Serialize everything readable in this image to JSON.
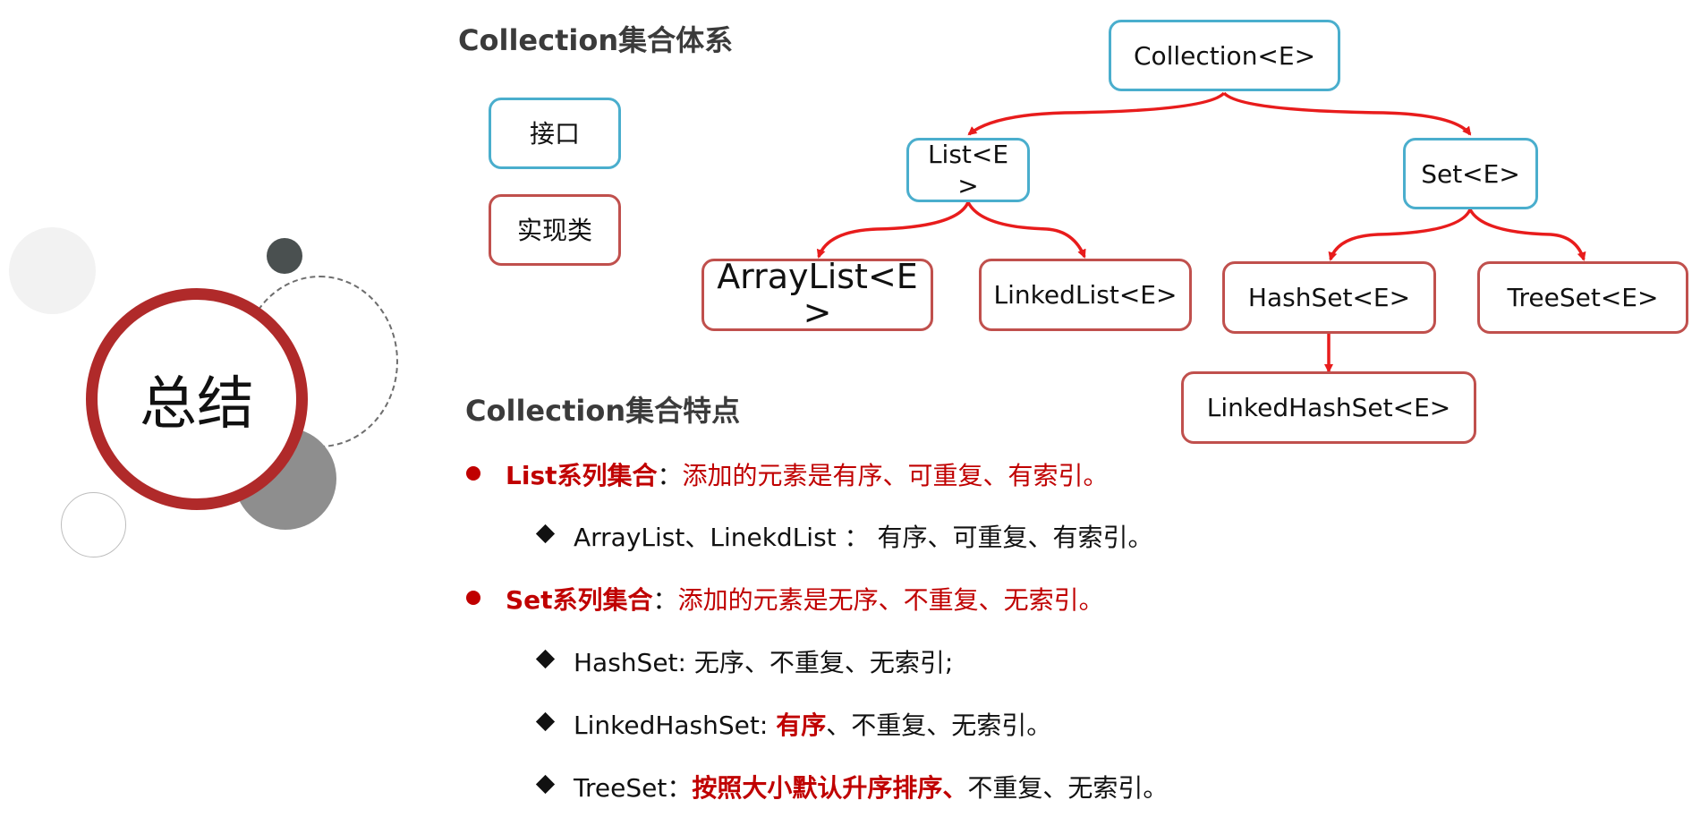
{
  "headings": {
    "system_title": "Collection集合体系",
    "features_title": "Collection集合特点"
  },
  "legend": {
    "interface_label": "接口",
    "impl_label": "实现类"
  },
  "summary_label": "总结",
  "tree": {
    "collection": "Collection<E>",
    "list": "List<E>",
    "set": "Set<E>",
    "arraylist": "ArrayList<E>",
    "linkedlist": "LinkedList<E>",
    "hashset": "HashSet<E>",
    "treeset": "TreeSet<E>",
    "linkedhashset": "LinkedHashSet<E>"
  },
  "features": {
    "list_name": "List系列集合",
    "list_sep": "：",
    "list_desc": "添加的元素是有序、可重复、有索引。",
    "list_sub_names": "ArrayList、LinekdList ：",
    "list_sub_desc": "有序、可重复、有索引。",
    "set_name": "Set系列集合",
    "set_sep": "：",
    "set_desc": "添加的元素是无序、不重复、无索引。",
    "hashset_text": "HashSet: 无序、不重复、无索引;",
    "lhs_prefix": "LinkedHashSet: ",
    "lhs_emph": "有序",
    "lhs_rest": "、不重复、无索引。",
    "treeset_prefix": "TreeSet：",
    "treeset_emph": "按照大小默认升序排序、",
    "treeset_rest": "不重复、无索引。"
  },
  "colors": {
    "interface_border": "#4aaecd",
    "impl_border": "#c0504d",
    "arrow": "#e81c1c",
    "accent_red": "#c00000"
  }
}
